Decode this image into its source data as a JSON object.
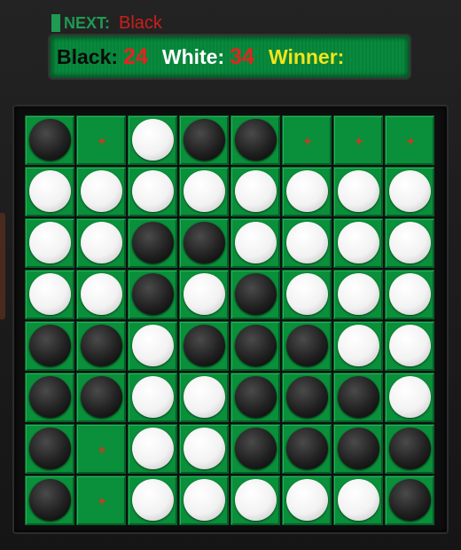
{
  "header": {
    "next_label": "NEXT:",
    "next_value": "Black"
  },
  "score": {
    "black_label": "Black:",
    "black_count": "24",
    "white_label": "White:",
    "white_count": "34",
    "winner_label": "Winner:",
    "winner_value": ""
  },
  "hint_glyph": "+",
  "colors": {
    "board_green": "#0a8f3a",
    "count_red": "#e5231f",
    "winner_yellow": "#f2e51a",
    "next_green": "#1f9a52"
  },
  "board": [
    [
      "B",
      "+",
      "W",
      "B",
      "B",
      "+",
      "+",
      "+"
    ],
    [
      "W",
      "W",
      "W",
      "W",
      "W",
      "W",
      "W",
      "W"
    ],
    [
      "W",
      "W",
      "B",
      "B",
      "W",
      "W",
      "W",
      "W"
    ],
    [
      "W",
      "W",
      "B",
      "W",
      "B",
      "W",
      "W",
      "W"
    ],
    [
      "B",
      "B",
      "W",
      "B",
      "B",
      "B",
      "W",
      "W"
    ],
    [
      "B",
      "B",
      "W",
      "W",
      "B",
      "B",
      "B",
      "W"
    ],
    [
      "B",
      "+",
      "W",
      "W",
      "B",
      "B",
      "B",
      "B"
    ],
    [
      "B",
      "+",
      "W",
      "W",
      "W",
      "W",
      "W",
      "B"
    ]
  ]
}
